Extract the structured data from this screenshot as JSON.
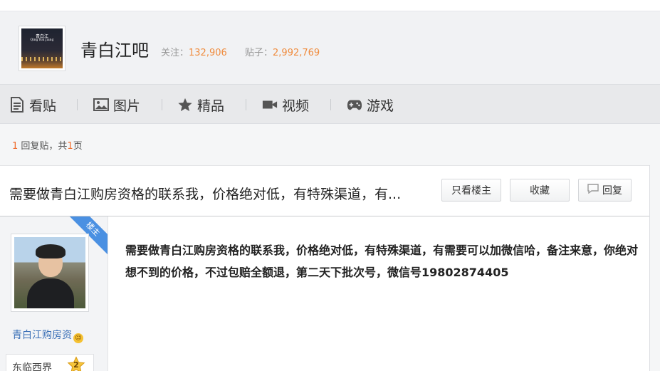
{
  "forum": {
    "thumb_title": "青白江",
    "thumb_subtitle": "Qing Bai Jiang",
    "name": "青白江吧",
    "follow_label": "关注：",
    "follow_count": "132,906",
    "posts_label": "贴子：",
    "posts_count": "2,992,769"
  },
  "tabs": [
    {
      "label": "看贴",
      "icon": "document-icon"
    },
    {
      "label": "图片",
      "icon": "image-icon"
    },
    {
      "label": "精品",
      "icon": "star-icon"
    },
    {
      "label": "视频",
      "icon": "video-camera-icon"
    },
    {
      "label": "游戏",
      "icon": "gamepad-icon"
    }
  ],
  "pager": {
    "reply_count": "1",
    "reply_text": " 回复贴，共",
    "page_count": "1",
    "page_text": "页"
  },
  "thread": {
    "title": "需要做青白江购房资格的联系我，价格绝对低，有特殊渠道，有...",
    "buttons": {
      "only_op": "只看楼主",
      "favorite": "收藏",
      "reply": "回复"
    }
  },
  "post": {
    "op_badge": "楼主",
    "username": "青白江购房资",
    "level_name": "东临西界",
    "level_number": "2",
    "content": "需要做青白江购房资格的联系我，价格绝对低，有特殊渠道，有需要可以加微信哈，备注来意，你绝对想不到的价格，不过包赔全额退，第二天下批次号，微信号19802874405"
  },
  "colors": {
    "accent_orange": "#f08c3e",
    "highlight_red": "#f06a2a",
    "link_blue": "#3a6fb6",
    "op_ribbon_blue": "#4a90e2"
  }
}
